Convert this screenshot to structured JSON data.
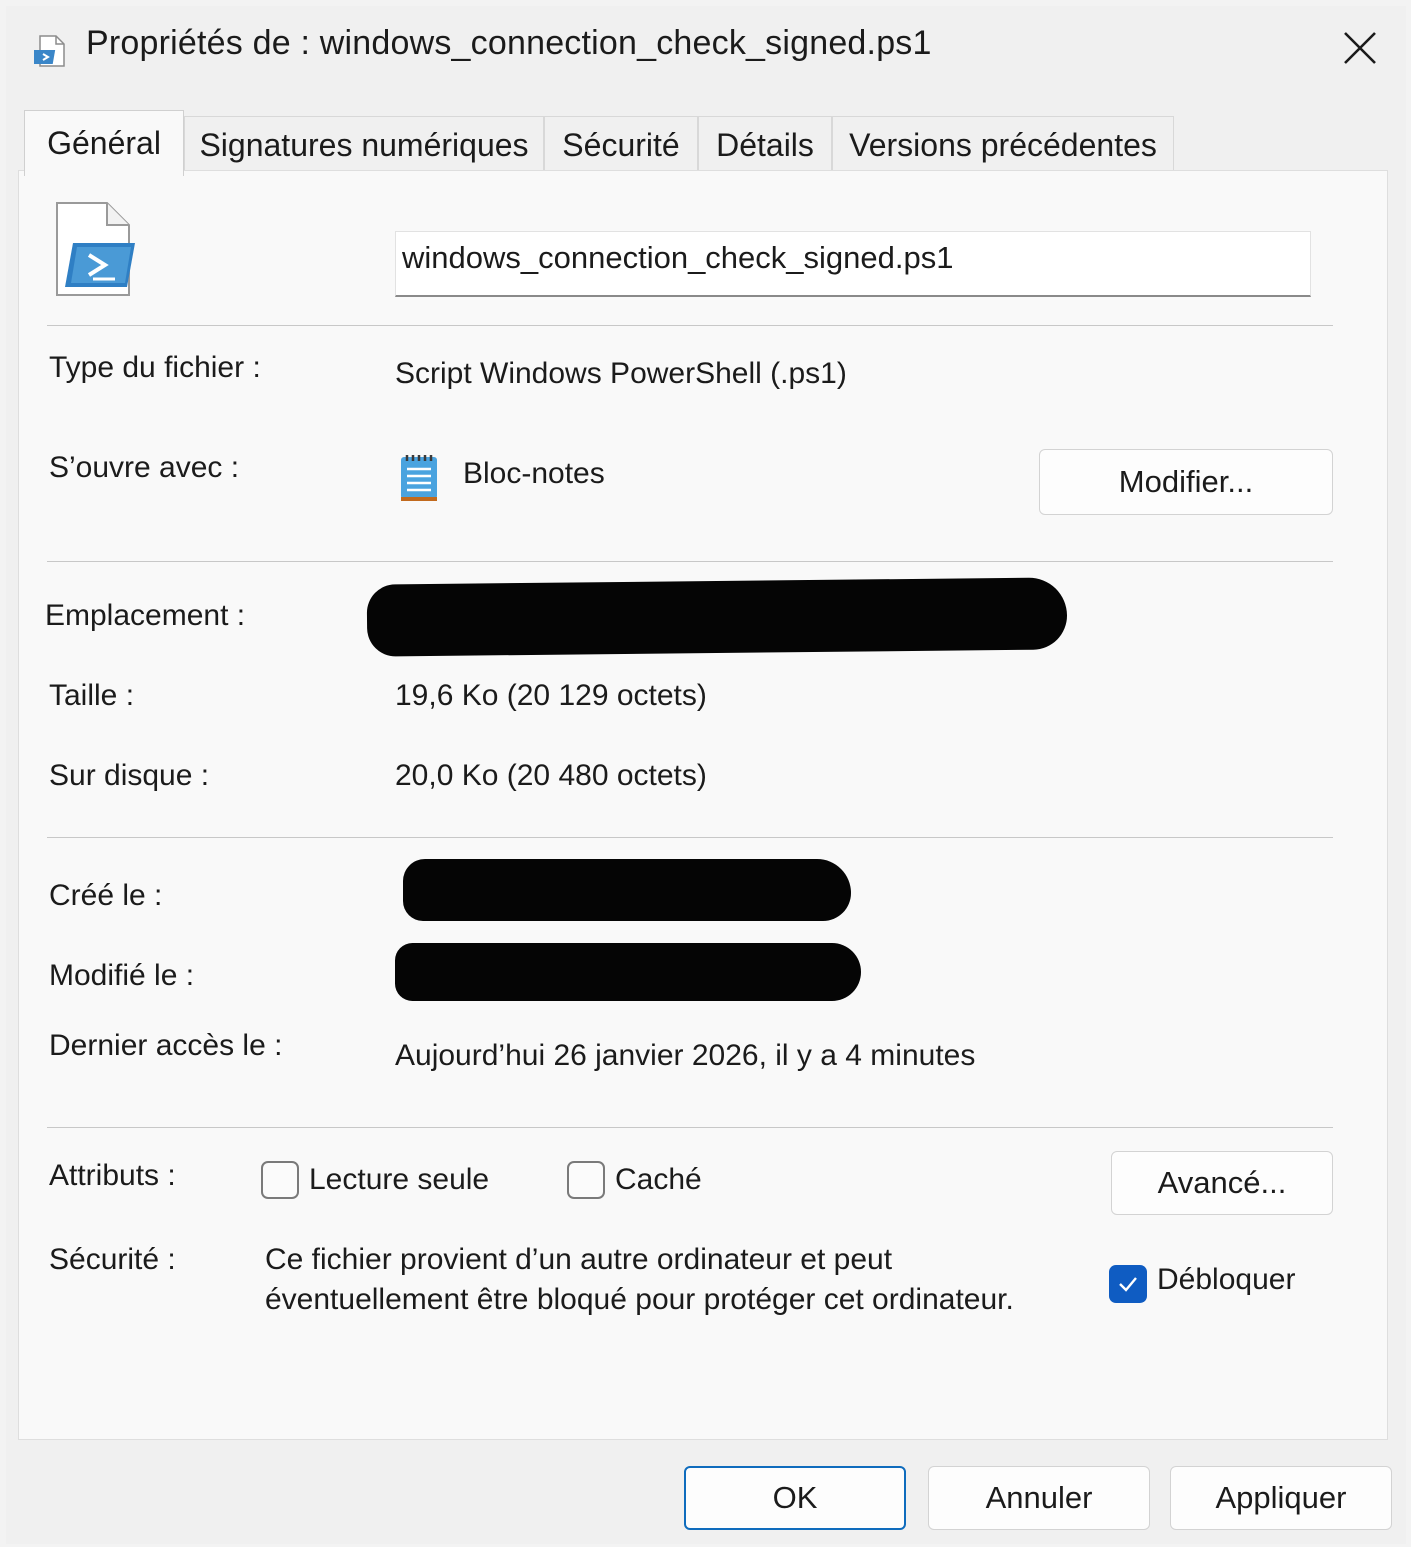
{
  "window": {
    "title": "Propriétés de : windows_connection_check_signed.ps1"
  },
  "tabs": [
    {
      "label": "Général",
      "active": true
    },
    {
      "label": "Signatures numériques"
    },
    {
      "label": "Sécurité"
    },
    {
      "label": "Détails"
    },
    {
      "label": "Versions précédentes"
    }
  ],
  "general": {
    "filename": "windows_connection_check_signed.ps1",
    "file_type_label": "Type du fichier :",
    "file_type_value": "Script Windows PowerShell (.ps1)",
    "opens_with_label": "S’ouvre avec :",
    "opens_with_value": "Bloc-notes",
    "change_button": "Modifier...",
    "location_label": "Emplacement :",
    "size_label": "Taille :",
    "size_value": "19,6 Ko (20 129 octets)",
    "on_disk_label": "Sur disque :",
    "on_disk_value": "20,0 Ko (20 480 octets)",
    "created_label": "Créé le :",
    "modified_label": "Modifié le :",
    "accessed_label": "Dernier accès le :",
    "accessed_value": "Aujourd’hui 26 janvier 2026, il y a 4 minutes",
    "attributes_label": "Attributs :",
    "readonly_label": "Lecture seule",
    "readonly_checked": false,
    "hidden_label": "Caché",
    "hidden_checked": false,
    "advanced_button": "Avancé...",
    "security_label": "Sécurité :",
    "security_text_line1": "Ce fichier provient d’un autre ordinateur et peut",
    "security_text_line2": "éventuellement être bloqué pour protéger cet ordinateur.",
    "unblock_label": "Débloquer",
    "unblock_checked": true
  },
  "footer": {
    "ok": "OK",
    "cancel": "Annuler",
    "apply": "Appliquer"
  },
  "colors": {
    "accent": "#0f5cc2",
    "redaction": "#050505"
  }
}
